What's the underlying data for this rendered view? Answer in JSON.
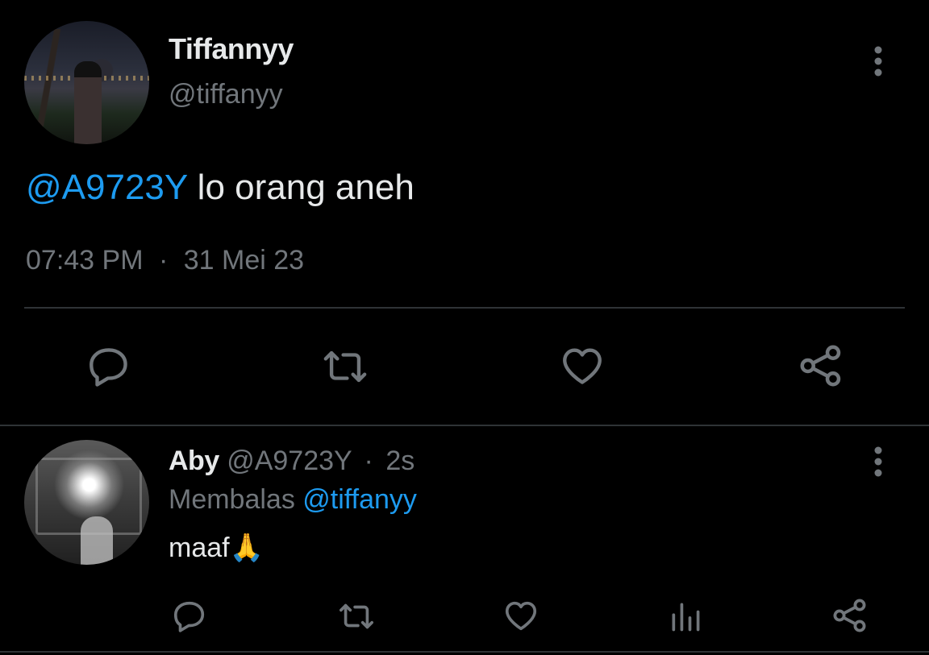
{
  "tweet": {
    "author_name": "Tiffannyy",
    "author_handle": "@tiffanyy",
    "mention": "@A9723Y",
    "text": " lo orang aneh",
    "time": "07:43 PM",
    "separator": "·",
    "date": "31 Mei 23"
  },
  "reply": {
    "author_name": "Aby",
    "author_handle": "@A9723Y",
    "separator": "·",
    "age": "2s",
    "replying_label": "Membalas",
    "replying_to": "@tiffanyy",
    "text": "maaf🙏"
  },
  "icons": {
    "more": "more-vertical-icon",
    "reply": "reply-bubble-icon",
    "retweet": "retweet-icon",
    "like": "heart-icon",
    "share": "share-icon",
    "views": "analytics-icon"
  },
  "colors": {
    "background": "#000000",
    "text": "#e7e9ea",
    "muted": "#71767b",
    "link": "#1d9bf0",
    "divider": "#2f3336"
  }
}
